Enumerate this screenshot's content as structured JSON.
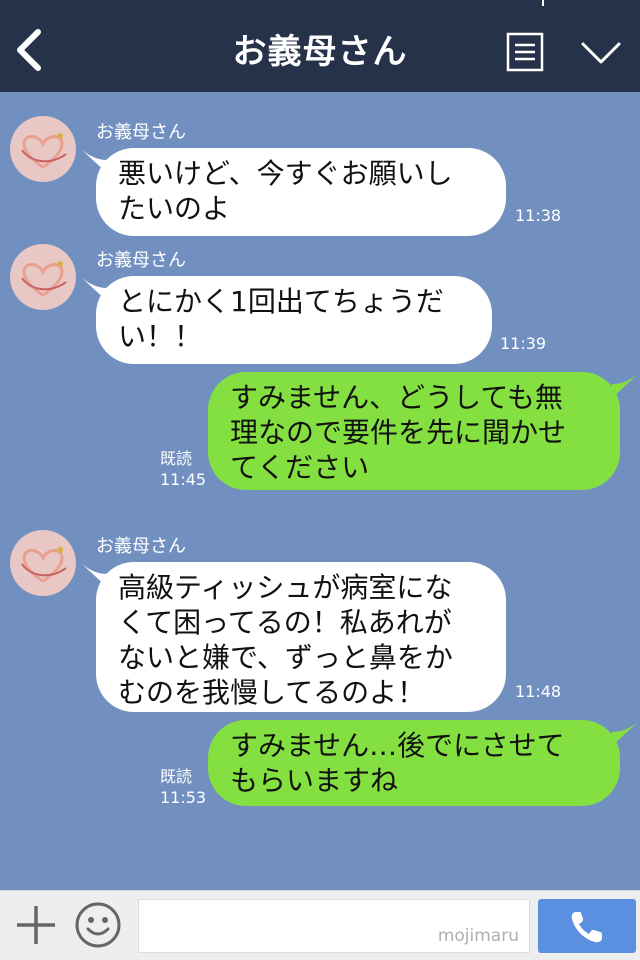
{
  "header": {
    "title": "お義母さん",
    "icons": [
      "back-icon",
      "menu-icon",
      "chevron-down-icon"
    ]
  },
  "messages": [
    {
      "direction": "incoming",
      "sender": "お義母さん",
      "lines": [
        "悪いけど、今すぐお願いし",
        "たいのよ"
      ],
      "time": "11:38"
    },
    {
      "direction": "incoming",
      "sender": "お義母さん",
      "lines": [
        "とにかく1回出てちょうだ",
        "い！！"
      ],
      "time": "11:39"
    },
    {
      "direction": "outgoing",
      "lines": [
        "すみません、どうしても無",
        "理なので要件を先に聞かせ",
        "てください"
      ],
      "read": "既読",
      "time": "11:45"
    },
    {
      "direction": "incoming",
      "sender": "お義母さん",
      "lines": [
        "高級ティッシュが病室にな",
        "くて困ってるの！私あれが",
        "ないと嫌で、ずっと鼻をか",
        "むのを我慢してるのよ！"
      ],
      "time": "11:48"
    },
    {
      "direction": "outgoing",
      "lines": [
        "すみません…後でにさせて",
        "もらいますね"
      ],
      "read": "既読",
      "time": "11:53"
    }
  ],
  "footer": {
    "input_value": "",
    "watermark": "mojimaru",
    "icons": [
      "plus-icon",
      "smile-icon",
      "phone-icon"
    ]
  },
  "colors": {
    "header_bg": "#263249",
    "chat_bg": "#7190c0",
    "incoming_bubble": "#ffffff",
    "outgoing_bubble": "#84e040",
    "call_button": "#5b8fe0"
  }
}
